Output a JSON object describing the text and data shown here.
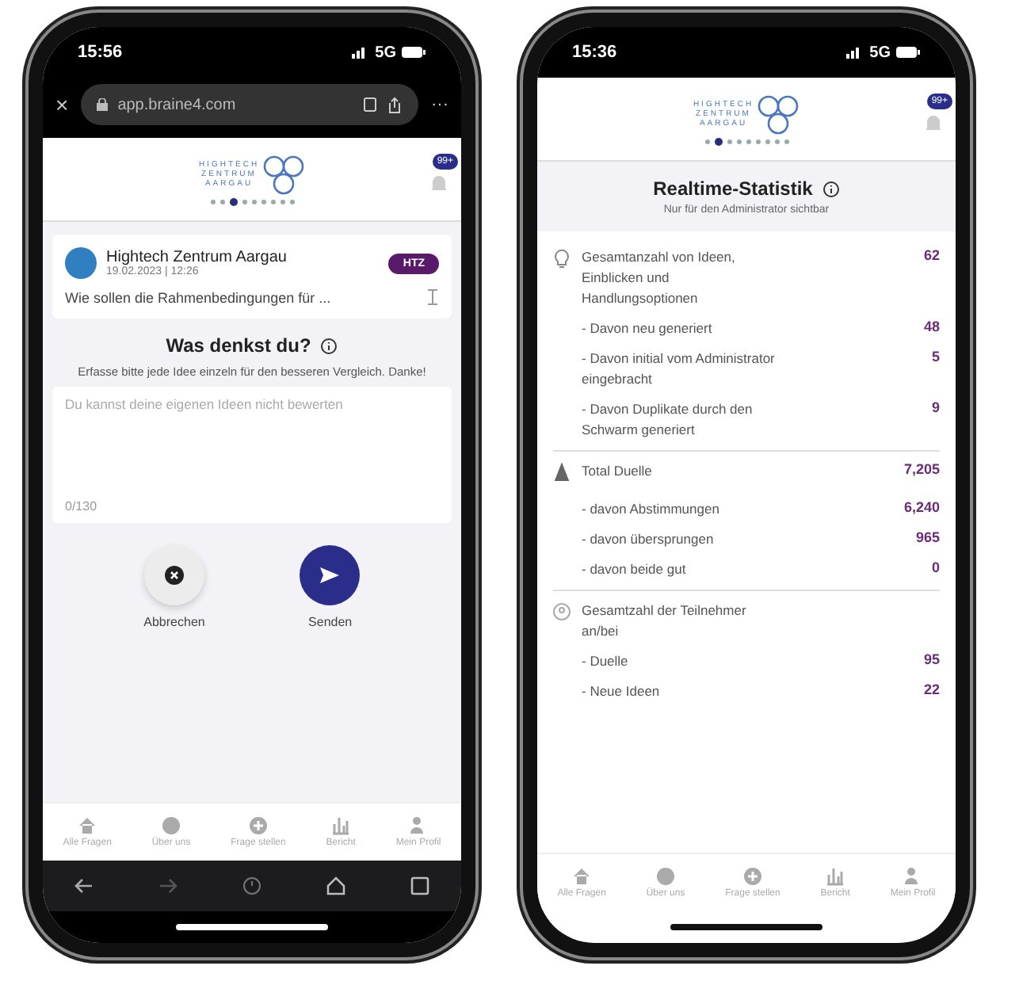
{
  "left_phone": {
    "status_bar": {
      "time": "15:56",
      "network": "5G"
    },
    "browser": {
      "close": "×",
      "url": "app.braine4.com",
      "more": "···"
    },
    "header": {
      "logo": [
        "HIGHTECH",
        "ZENTRUM",
        "AARGAU"
      ],
      "badge": "99+",
      "pager": [
        {
          "selected": false
        },
        {
          "selected": false
        },
        {
          "selected": true
        },
        {
          "selected": false
        },
        {
          "selected": false
        },
        {
          "selected": false
        },
        {
          "selected": false
        },
        {
          "selected": false
        },
        {
          "selected": false
        }
      ]
    },
    "question_card": {
      "org": "Hightech Zentrum Aargau",
      "date": "19.02.2023 | 12:26",
      "tag": "HTZ",
      "question": "Wie sollen die Rahmenbedingungen für ..."
    },
    "prompt": {
      "title": "Was denkst du?",
      "hint": "Erfasse bitte jede Idee einzeln für den besseren Vergleich. Danke!"
    },
    "idea_field": {
      "placeholder": "Du kannst deine eigenen Ideen nicht bewerten",
      "counter": "0/130"
    },
    "actions": [
      {
        "kind": "cancel",
        "label": "Abbrechen"
      },
      {
        "kind": "send",
        "label": "Senden"
      }
    ],
    "tab_bar": [
      "Alle Fragen",
      "Über uns",
      "Frage stellen",
      "Bericht",
      "Mein Profil"
    ]
  },
  "right_phone": {
    "status_bar": {
      "time": "15:36",
      "network": "5G"
    },
    "header": {
      "logo": [
        "HIGHTECH",
        "ZENTRUM",
        "AARGAU"
      ],
      "badge": "99+",
      "pager": [
        {
          "selected": false
        },
        {
          "selected": true
        },
        {
          "selected": false
        },
        {
          "selected": false
        },
        {
          "selected": false
        },
        {
          "selected": false
        },
        {
          "selected": false
        },
        {
          "selected": false
        },
        {
          "selected": false
        }
      ]
    },
    "title": "Realtime-Statistik",
    "subtitle": "Nur für den Administrator sichtbar",
    "sections": [
      {
        "rows": [
          {
            "label": "Gesamtanzahl von Ideen, Einblicken und Handlungsoptionen",
            "value": "62"
          },
          {
            "label": "- Davon neu generiert",
            "value": "48"
          },
          {
            "label": "- Davon initial vom Administrator eingebracht",
            "value": "5"
          },
          {
            "label": "- Davon Duplikate durch den Schwarm generiert",
            "value": "9"
          }
        ]
      },
      {
        "rows": [
          {
            "label": "Total Duelle",
            "value": "7,205"
          },
          {
            "label": "- davon Abstimmungen",
            "value": "6,240"
          },
          {
            "label": "- davon übersprungen",
            "value": "965"
          },
          {
            "label": "- davon beide gut",
            "value": "0"
          }
        ]
      },
      {
        "rows": [
          {
            "label": "Gesamtzahl der Teilnehmer an/bei"
          },
          {
            "label": "- Duelle",
            "value": "95"
          },
          {
            "label": "- Neue Ideen",
            "value": "22"
          }
        ]
      }
    ],
    "tab_bar": [
      "Alle Fragen",
      "Über uns",
      "Frage stellen",
      "Bericht",
      "Mein Profil"
    ]
  }
}
